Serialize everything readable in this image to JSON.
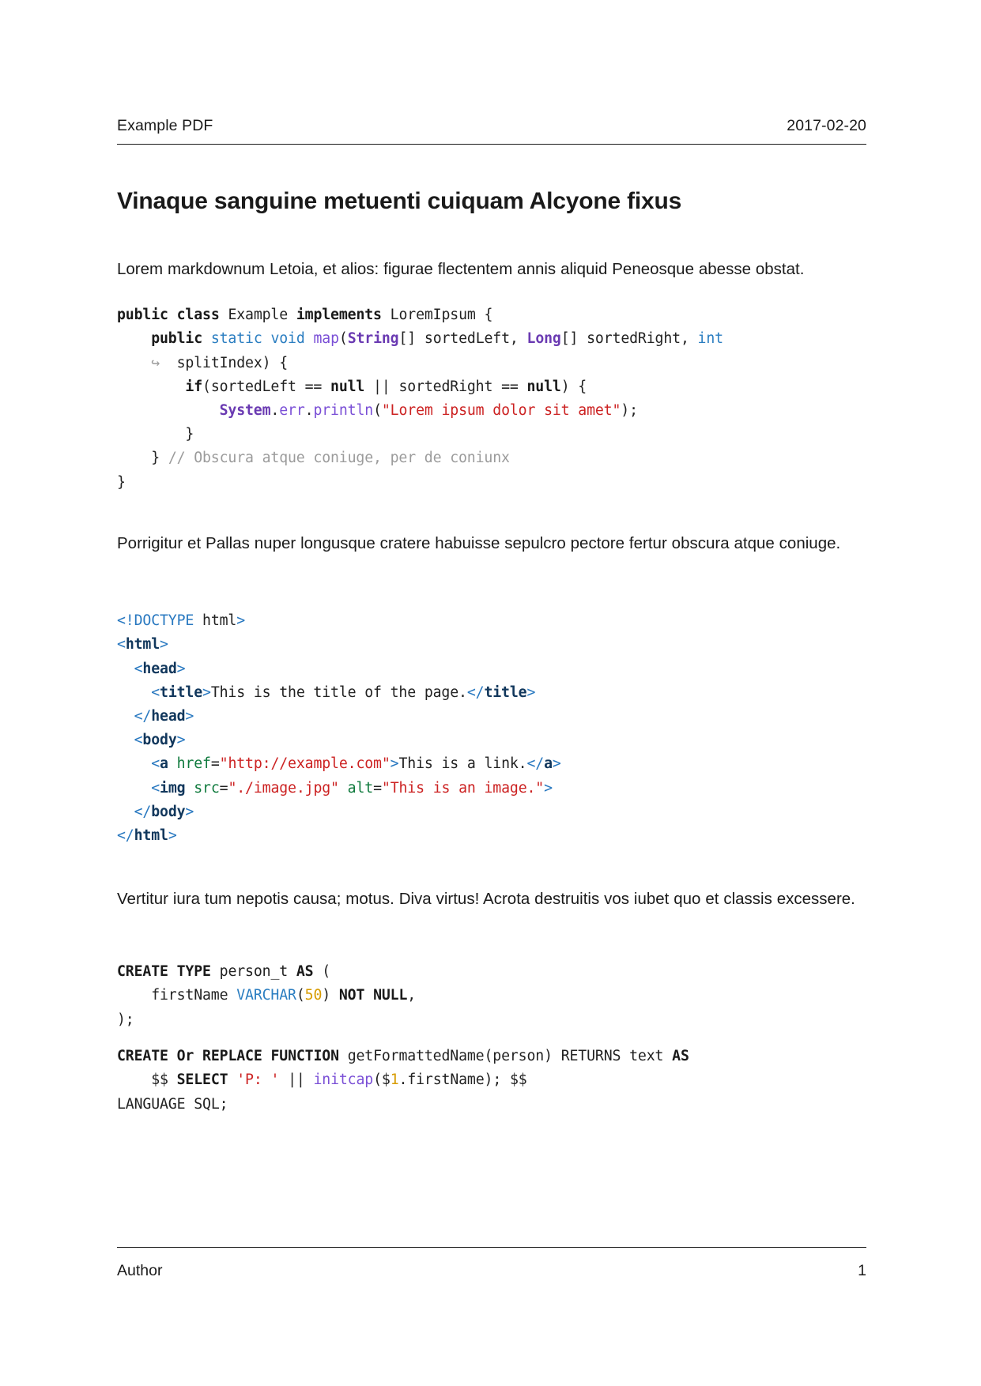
{
  "header": {
    "left": "Example PDF",
    "right": "2017-02-20"
  },
  "title": "Vinaque sanguine metuenti cuiquam Alcyone fixus",
  "paragraphs": {
    "p1": "Lorem markdownum Letoia, et alios: figurae flectentem annis aliquid Peneosque abesse obstat.",
    "p2": "Porrigitur et Pallas nuper longusque cratere habuisse sepulcro pectore fertur obscura atque coniuge.",
    "p3": "Vertitur iura tum nepotis causa; motus.  Diva virtus!  Acrota destruitis vos iubet quo et classis excessere."
  },
  "code": {
    "java": {
      "language": "java",
      "tokens": {
        "kw_public": "public",
        "kw_class": "class",
        "name_example": "Example",
        "kw_implements": "implements",
        "name_loremipsum": "LoremIpsum",
        "brace_open": "{",
        "kw_static": "static",
        "kw_void": "void",
        "fn_map": "map",
        "type_string": "String",
        "arg_sortedleft": "sortedLeft",
        "type_long": "Long",
        "arg_sortedright": "sortedRight",
        "kw_int": "int",
        "wrap_arrow": "↪",
        "arg_splitindex": "splitIndex",
        "kw_if": "if",
        "kw_null": "null",
        "op_or": "||",
        "type_system": "System",
        "fn_err": "err",
        "fn_println": "println",
        "string_lorem": "\"Lorem ipsum dolor sit amet\"",
        "comment": "// Obscura atque coniuge, per de coniunx",
        "brace_close": "}"
      },
      "plain_text": "public class Example implements LoremIpsum {\n    public static void map(String[] sortedLeft, Long[] sortedRight, int\n    ↪  splitIndex) {\n        if(sortedLeft == null || sortedRight == null) {\n            System.err.println(\"Lorem ipsum dolor sit amet\");\n        }\n    } // Obscura atque coniuge, per de coniunx\n}"
    },
    "html": {
      "language": "html",
      "tokens": {
        "doctype": "<!DOCTYPE",
        "doctype_value": "html",
        "tag_html": "html",
        "tag_head": "head",
        "tag_title": "title",
        "title_text": "This is the title of the page.",
        "tag_body": "body",
        "tag_a": "a",
        "attr_href": "href",
        "value_href": "\"http://example.com\"",
        "link_text": "This is a link.",
        "tag_img": "img",
        "attr_src": "src",
        "value_src": "\"./image.jpg\"",
        "attr_alt": "alt",
        "value_alt": "\"This is an image.\""
      },
      "plain_text": "<!DOCTYPE html>\n<html>\n  <head>\n    <title>This is the title of the page.</title>\n  </head>\n  <body>\n    <a href=\"http://example.com\">This is a link.</a>\n    <img src=\"./image.jpg\" alt=\"This is an image.\">\n  </body>\n</html>"
    },
    "sql1": {
      "language": "sql",
      "tokens": {
        "kw_create": "CREATE",
        "kw_type": "TYPE",
        "name_person_t": "person_t",
        "kw_as": "AS",
        "col_firstname": "firstName",
        "type_varchar": "VARCHAR",
        "num_50": "50",
        "kw_not": "NOT",
        "kw_null": "NULL"
      },
      "plain_text": "CREATE TYPE person_t AS (\n    firstName VARCHAR(50) NOT NULL,\n);"
    },
    "sql2": {
      "language": "sql",
      "tokens": {
        "kw_create": "CREATE",
        "kw_or": "Or",
        "kw_replace": "REPLACE",
        "kw_function": "FUNCTION",
        "fn_name": "getFormattedName(person)",
        "kw_returns": "RETURNS",
        "type_text": "text",
        "kw_as": "AS",
        "dollar_quote": "$$",
        "kw_select": "SELECT",
        "string_p": "'P: '",
        "op_concat": "||",
        "fn_initcap": "initcap",
        "var_dollar": "$",
        "var_num": "1",
        "var_field": ".firstName",
        "kw_language": "LANGUAGE",
        "kw_sql": "SQL;"
      },
      "plain_text": "CREATE Or REPLACE FUNCTION getFormattedName(person) RETURNS text AS\n    $$ SELECT 'P: ' || initcap($1.firstName); $$\nLANGUAGE SQL;"
    }
  },
  "footer": {
    "left": "Author",
    "right": "1"
  },
  "colors": {
    "text": "#1a1a1a",
    "keyword": "#1a1a1a",
    "blue": "#2b7ec1",
    "type": "#6a3ab2",
    "function": "#7a4fd6",
    "string": "#cc2222",
    "comment": "#9b9b9b",
    "tag_bracket": "#2878c0",
    "tag_name": "#11375c",
    "attribute": "#0f7a3d",
    "number": "#d79b00"
  }
}
